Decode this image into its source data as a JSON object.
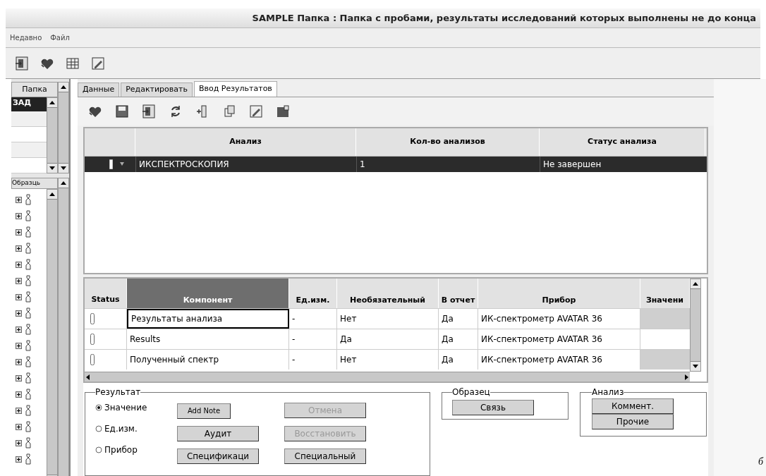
{
  "window": {
    "title": "SAMPLE Папка : Папка с пробами, результаты исследований которых выполнены не до конца"
  },
  "menu": [
    "Недавно",
    "Файл"
  ],
  "folder_panel": {
    "header": "Папка",
    "items": [
      {
        "label": "ЗАД",
        "selected": true
      }
    ]
  },
  "sample_panel": {
    "header": "Образць",
    "items": [
      {
        "expanded": false
      },
      {
        "expanded": false
      },
      {
        "expanded": false
      },
      {
        "expanded": false
      },
      {
        "expanded": false
      },
      {
        "expanded": false
      },
      {
        "expanded": false
      },
      {
        "expanded": false
      },
      {
        "expanded": false
      },
      {
        "expanded": false
      },
      {
        "expanded": false
      },
      {
        "expanded": false
      },
      {
        "expanded": false
      },
      {
        "expanded": false
      },
      {
        "expanded": false
      },
      {
        "expanded": false
      },
      {
        "expanded": false
      }
    ]
  },
  "tabs": [
    {
      "label": "Данные",
      "selected": false
    },
    {
      "label": "Редактировать",
      "selected": false
    },
    {
      "label": "Ввод Результатов",
      "selected": true
    }
  ],
  "analysis_table": {
    "columns": [
      "Анализ",
      "Кол-во анализов",
      "Статус анализа"
    ],
    "rows": [
      {
        "cells": [
          "ИКСПЕКТРОСКОПИЯ",
          "1",
          "Не завершен"
        ],
        "selected": true
      }
    ]
  },
  "component_table": {
    "status_column": {
      "label": "Status",
      "selected": false
    },
    "columns": [
      {
        "label": "Компонент",
        "selected": true
      },
      {
        "label": "Ед.изм.",
        "selected": false
      },
      {
        "label": "Необязательный",
        "selected": false
      },
      {
        "label": "В отчет",
        "selected": false
      },
      {
        "label": "Прибор",
        "selected": false
      },
      {
        "label": "Значени",
        "selected": false
      }
    ],
    "rows": [
      {
        "cells": [
          "Результаты анализа",
          "-",
          "Нет",
          "Да",
          "ИК-спектрометр AVATAR 36"
        ],
        "focused": true,
        "value_locked": true
      },
      {
        "cells": [
          "Results",
          "-",
          "Да",
          "Да",
          "ИК-спектрометр AVATAR 36"
        ],
        "focused": false,
        "value_locked": false
      },
      {
        "cells": [
          "Полученный спектр",
          "-",
          "Нет",
          "Да",
          "ИК-спектрометр AVATAR 36"
        ],
        "focused": false,
        "value_locked": true
      }
    ]
  },
  "result_group": {
    "title": "Результат",
    "options": [
      {
        "label": "Значение",
        "selected": true
      },
      {
        "label": "Ед.изм.",
        "selected": false
      },
      {
        "label": "Прибор",
        "selected": false
      }
    ],
    "buttons": [
      {
        "label": "Add Note",
        "disabled": false,
        "kind": "small"
      },
      {
        "label": "Отмена",
        "disabled": true,
        "kind": "normal"
      },
      {
        "label": "Аудит",
        "disabled": false,
        "kind": "normal"
      },
      {
        "label": "Восстановить",
        "disabled": true,
        "kind": "normal"
      },
      {
        "label": "Спецификаци",
        "disabled": false,
        "kind": "normal"
      },
      {
        "label": "Специальный",
        "disabled": false,
        "kind": "normal"
      }
    ]
  },
  "sample_group": {
    "title": "Образец",
    "buttons": [
      "Связь"
    ]
  },
  "analysis_group": {
    "title": "Анализ",
    "buttons": [
      "Коммент.",
      "Прочие"
    ]
  },
  "caption": "б"
}
